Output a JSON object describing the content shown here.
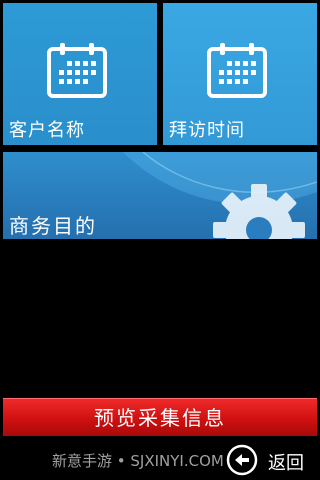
{
  "tiles": {
    "customer_name": {
      "label": "客户名称",
      "icon": "calendar-icon"
    },
    "visit_time": {
      "label": "拜访时间",
      "icon": "calendar-icon"
    },
    "business_purpose": {
      "label": "商务目的",
      "icon": "gear-icon"
    }
  },
  "actions": {
    "preview_label": "预览采集信息"
  },
  "footer": {
    "watermark": "新意手游 • SJXINYI.COM",
    "back_label": "返回",
    "back_icon": "back-arrow-icon"
  },
  "colors": {
    "tile_blue": "#2d9ad6",
    "tile_blue_light": "#3aa8e4",
    "button_red": "#d41414",
    "background": "#000000"
  }
}
